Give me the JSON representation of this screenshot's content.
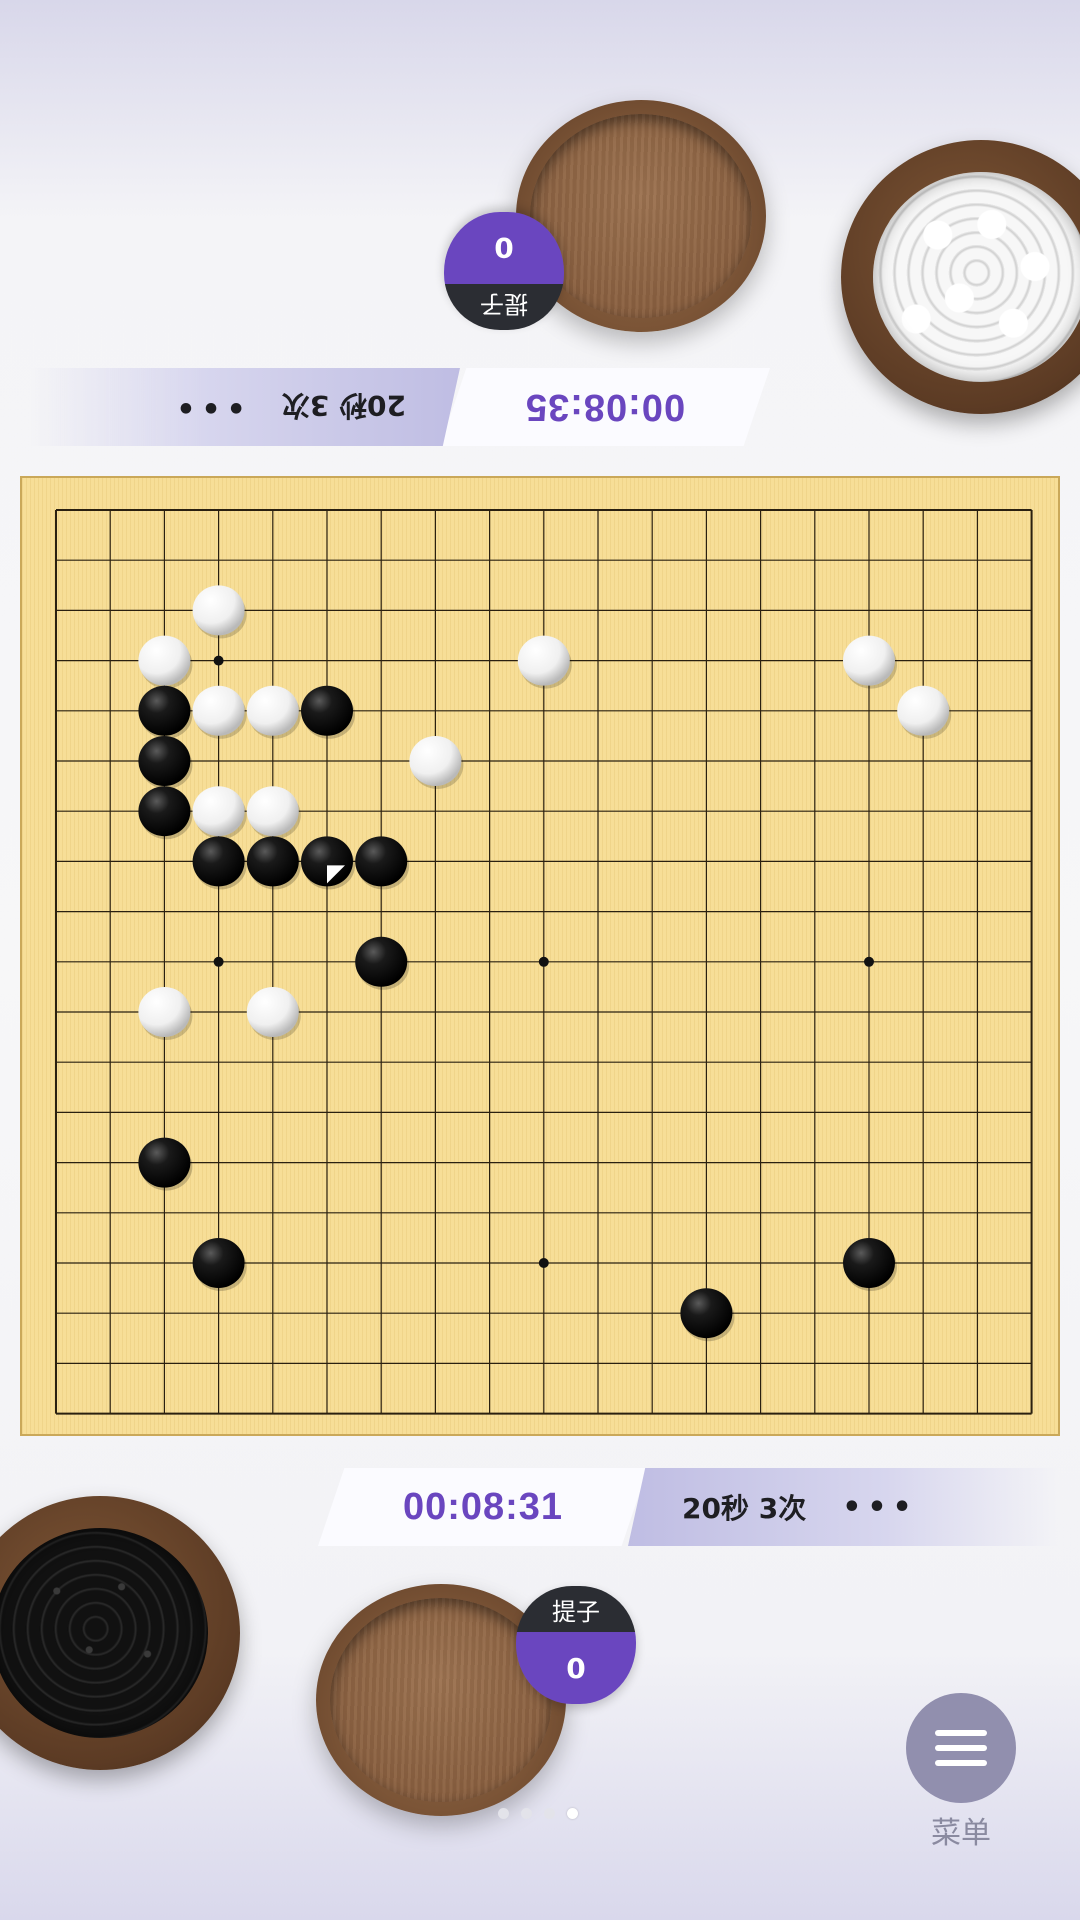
{
  "opponent": {
    "capture_label": "提子",
    "capture_count": "0",
    "main_time": "00:08:35",
    "byoyomi": "20秒 3次",
    "more": "•••"
  },
  "player": {
    "capture_label": "提子",
    "capture_count": "0",
    "main_time": "00:08:31",
    "byoyomi": "20秒 3次",
    "more": "•••"
  },
  "board": {
    "size": 19,
    "star_points": [
      [
        3,
        3
      ],
      [
        3,
        9
      ],
      [
        3,
        15
      ],
      [
        9,
        3
      ],
      [
        9,
        9
      ],
      [
        9,
        15
      ],
      [
        15,
        3
      ],
      [
        15,
        9
      ],
      [
        15,
        15
      ]
    ],
    "white_stones": [
      [
        3,
        2
      ],
      [
        2,
        3
      ],
      [
        3,
        4
      ],
      [
        4,
        4
      ],
      [
        9,
        3
      ],
      [
        15,
        3
      ],
      [
        16,
        4
      ],
      [
        7,
        5
      ],
      [
        3,
        6
      ],
      [
        4,
        6
      ],
      [
        2,
        10
      ],
      [
        4,
        10
      ]
    ],
    "black_stones": [
      [
        2,
        4
      ],
      [
        5,
        4
      ],
      [
        2,
        5
      ],
      [
        2,
        6
      ],
      [
        3,
        7
      ],
      [
        4,
        7
      ],
      [
        5,
        7
      ],
      [
        6,
        7
      ],
      [
        6,
        9
      ],
      [
        2,
        13
      ],
      [
        3,
        15
      ],
      [
        15,
        15
      ],
      [
        12,
        16
      ]
    ],
    "last_move": [
      5,
      7
    ],
    "colors": {
      "wood": "#f7de97",
      "line": "#2a2010"
    }
  },
  "pager": {
    "count": 4,
    "active": 3
  },
  "menu": {
    "label": "菜单"
  },
  "colors": {
    "accent": "#6a46bf",
    "menu": "#918fae"
  }
}
